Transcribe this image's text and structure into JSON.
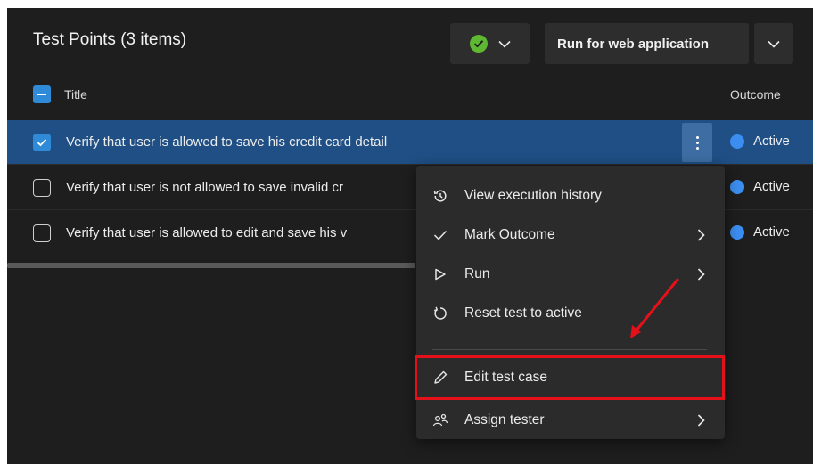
{
  "header": {
    "title": "Test Points (3 items)",
    "run_button_label": "Run for web application"
  },
  "columns": {
    "title": "Title",
    "outcome": "Outcome"
  },
  "rows": [
    {
      "title": "Verify that user is allowed to save his credit card detail",
      "outcome": "Active",
      "selected": true
    },
    {
      "title": "Verify that user is not allowed to save invalid cr",
      "outcome": "Active",
      "selected": false
    },
    {
      "title": "Verify that user is allowed to edit and save his v",
      "outcome": "Active",
      "selected": false
    }
  ],
  "context_menu": {
    "items": [
      {
        "label": "View execution history",
        "icon": "history-icon"
      },
      {
        "label": "Mark Outcome",
        "icon": "check-icon",
        "submenu": true
      },
      {
        "label": "Run",
        "icon": "play-icon",
        "submenu": true
      },
      {
        "label": "Reset test to active",
        "icon": "reset-icon"
      },
      {
        "label": "Edit test case",
        "icon": "pencil-icon",
        "highlighted": true
      },
      {
        "label": "Assign tester",
        "icon": "assign-tester-icon",
        "submenu": true
      }
    ]
  },
  "colors": {
    "panel_bg": "#1e1e1e",
    "selected_row": "#1f4f85",
    "accent_blue": "#2f8ad8",
    "status_green": "#5fb832",
    "outcome_active": "#3b8ef0",
    "annotation_red": "#e4111b"
  }
}
